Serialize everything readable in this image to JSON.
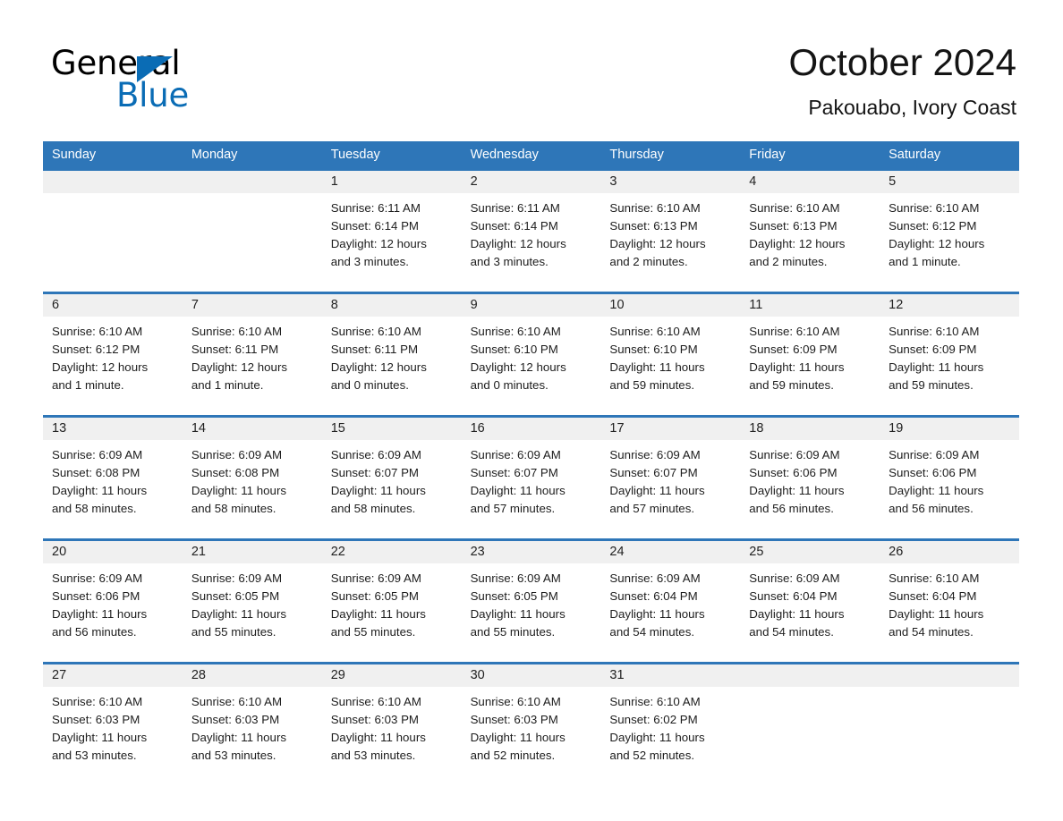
{
  "brand": {
    "name_part1": "General",
    "name_part2": "Blue",
    "accent_color": "#0a6cb5"
  },
  "header": {
    "month_title": "October 2024",
    "location": "Pakouabo, Ivory Coast"
  },
  "calendar": {
    "header_bg": "#2e76b8",
    "daynum_bg": "#f0f0f0",
    "weekdays": [
      "Sunday",
      "Monday",
      "Tuesday",
      "Wednesday",
      "Thursday",
      "Friday",
      "Saturday"
    ],
    "weeks": [
      [
        {
          "day": "",
          "sunrise": "",
          "sunset": "",
          "daylight1": "",
          "daylight2": ""
        },
        {
          "day": "",
          "sunrise": "",
          "sunset": "",
          "daylight1": "",
          "daylight2": ""
        },
        {
          "day": "1",
          "sunrise": "Sunrise: 6:11 AM",
          "sunset": "Sunset: 6:14 PM",
          "daylight1": "Daylight: 12 hours",
          "daylight2": "and 3 minutes."
        },
        {
          "day": "2",
          "sunrise": "Sunrise: 6:11 AM",
          "sunset": "Sunset: 6:14 PM",
          "daylight1": "Daylight: 12 hours",
          "daylight2": "and 3 minutes."
        },
        {
          "day": "3",
          "sunrise": "Sunrise: 6:10 AM",
          "sunset": "Sunset: 6:13 PM",
          "daylight1": "Daylight: 12 hours",
          "daylight2": "and 2 minutes."
        },
        {
          "day": "4",
          "sunrise": "Sunrise: 6:10 AM",
          "sunset": "Sunset: 6:13 PM",
          "daylight1": "Daylight: 12 hours",
          "daylight2": "and 2 minutes."
        },
        {
          "day": "5",
          "sunrise": "Sunrise: 6:10 AM",
          "sunset": "Sunset: 6:12 PM",
          "daylight1": "Daylight: 12 hours",
          "daylight2": "and 1 minute."
        }
      ],
      [
        {
          "day": "6",
          "sunrise": "Sunrise: 6:10 AM",
          "sunset": "Sunset: 6:12 PM",
          "daylight1": "Daylight: 12 hours",
          "daylight2": "and 1 minute."
        },
        {
          "day": "7",
          "sunrise": "Sunrise: 6:10 AM",
          "sunset": "Sunset: 6:11 PM",
          "daylight1": "Daylight: 12 hours",
          "daylight2": "and 1 minute."
        },
        {
          "day": "8",
          "sunrise": "Sunrise: 6:10 AM",
          "sunset": "Sunset: 6:11 PM",
          "daylight1": "Daylight: 12 hours",
          "daylight2": "and 0 minutes."
        },
        {
          "day": "9",
          "sunrise": "Sunrise: 6:10 AM",
          "sunset": "Sunset: 6:10 PM",
          "daylight1": "Daylight: 12 hours",
          "daylight2": "and 0 minutes."
        },
        {
          "day": "10",
          "sunrise": "Sunrise: 6:10 AM",
          "sunset": "Sunset: 6:10 PM",
          "daylight1": "Daylight: 11 hours",
          "daylight2": "and 59 minutes."
        },
        {
          "day": "11",
          "sunrise": "Sunrise: 6:10 AM",
          "sunset": "Sunset: 6:09 PM",
          "daylight1": "Daylight: 11 hours",
          "daylight2": "and 59 minutes."
        },
        {
          "day": "12",
          "sunrise": "Sunrise: 6:10 AM",
          "sunset": "Sunset: 6:09 PM",
          "daylight1": "Daylight: 11 hours",
          "daylight2": "and 59 minutes."
        }
      ],
      [
        {
          "day": "13",
          "sunrise": "Sunrise: 6:09 AM",
          "sunset": "Sunset: 6:08 PM",
          "daylight1": "Daylight: 11 hours",
          "daylight2": "and 58 minutes."
        },
        {
          "day": "14",
          "sunrise": "Sunrise: 6:09 AM",
          "sunset": "Sunset: 6:08 PM",
          "daylight1": "Daylight: 11 hours",
          "daylight2": "and 58 minutes."
        },
        {
          "day": "15",
          "sunrise": "Sunrise: 6:09 AM",
          "sunset": "Sunset: 6:07 PM",
          "daylight1": "Daylight: 11 hours",
          "daylight2": "and 58 minutes."
        },
        {
          "day": "16",
          "sunrise": "Sunrise: 6:09 AM",
          "sunset": "Sunset: 6:07 PM",
          "daylight1": "Daylight: 11 hours",
          "daylight2": "and 57 minutes."
        },
        {
          "day": "17",
          "sunrise": "Sunrise: 6:09 AM",
          "sunset": "Sunset: 6:07 PM",
          "daylight1": "Daylight: 11 hours",
          "daylight2": "and 57 minutes."
        },
        {
          "day": "18",
          "sunrise": "Sunrise: 6:09 AM",
          "sunset": "Sunset: 6:06 PM",
          "daylight1": "Daylight: 11 hours",
          "daylight2": "and 56 minutes."
        },
        {
          "day": "19",
          "sunrise": "Sunrise: 6:09 AM",
          "sunset": "Sunset: 6:06 PM",
          "daylight1": "Daylight: 11 hours",
          "daylight2": "and 56 minutes."
        }
      ],
      [
        {
          "day": "20",
          "sunrise": "Sunrise: 6:09 AM",
          "sunset": "Sunset: 6:06 PM",
          "daylight1": "Daylight: 11 hours",
          "daylight2": "and 56 minutes."
        },
        {
          "day": "21",
          "sunrise": "Sunrise: 6:09 AM",
          "sunset": "Sunset: 6:05 PM",
          "daylight1": "Daylight: 11 hours",
          "daylight2": "and 55 minutes."
        },
        {
          "day": "22",
          "sunrise": "Sunrise: 6:09 AM",
          "sunset": "Sunset: 6:05 PM",
          "daylight1": "Daylight: 11 hours",
          "daylight2": "and 55 minutes."
        },
        {
          "day": "23",
          "sunrise": "Sunrise: 6:09 AM",
          "sunset": "Sunset: 6:05 PM",
          "daylight1": "Daylight: 11 hours",
          "daylight2": "and 55 minutes."
        },
        {
          "day": "24",
          "sunrise": "Sunrise: 6:09 AM",
          "sunset": "Sunset: 6:04 PM",
          "daylight1": "Daylight: 11 hours",
          "daylight2": "and 54 minutes."
        },
        {
          "day": "25",
          "sunrise": "Sunrise: 6:09 AM",
          "sunset": "Sunset: 6:04 PM",
          "daylight1": "Daylight: 11 hours",
          "daylight2": "and 54 minutes."
        },
        {
          "day": "26",
          "sunrise": "Sunrise: 6:10 AM",
          "sunset": "Sunset: 6:04 PM",
          "daylight1": "Daylight: 11 hours",
          "daylight2": "and 54 minutes."
        }
      ],
      [
        {
          "day": "27",
          "sunrise": "Sunrise: 6:10 AM",
          "sunset": "Sunset: 6:03 PM",
          "daylight1": "Daylight: 11 hours",
          "daylight2": "and 53 minutes."
        },
        {
          "day": "28",
          "sunrise": "Sunrise: 6:10 AM",
          "sunset": "Sunset: 6:03 PM",
          "daylight1": "Daylight: 11 hours",
          "daylight2": "and 53 minutes."
        },
        {
          "day": "29",
          "sunrise": "Sunrise: 6:10 AM",
          "sunset": "Sunset: 6:03 PM",
          "daylight1": "Daylight: 11 hours",
          "daylight2": "and 53 minutes."
        },
        {
          "day": "30",
          "sunrise": "Sunrise: 6:10 AM",
          "sunset": "Sunset: 6:03 PM",
          "daylight1": "Daylight: 11 hours",
          "daylight2": "and 52 minutes."
        },
        {
          "day": "31",
          "sunrise": "Sunrise: 6:10 AM",
          "sunset": "Sunset: 6:02 PM",
          "daylight1": "Daylight: 11 hours",
          "daylight2": "and 52 minutes."
        },
        {
          "day": "",
          "sunrise": "",
          "sunset": "",
          "daylight1": "",
          "daylight2": ""
        },
        {
          "day": "",
          "sunrise": "",
          "sunset": "",
          "daylight1": "",
          "daylight2": ""
        }
      ]
    ]
  }
}
